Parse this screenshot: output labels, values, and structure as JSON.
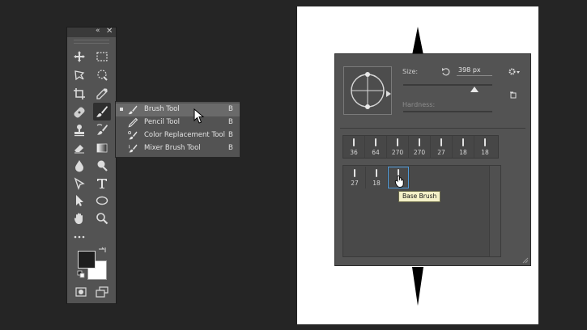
{
  "toolbar": {
    "collapse_glyph": "«",
    "close_glyph": "✕",
    "tools": [
      "move-icon",
      "marquee-icon",
      "lasso-icon",
      "quick-select-icon",
      "crop-icon",
      "eyedropper-icon",
      "healing-icon",
      "brush-icon",
      "stamp-icon",
      "history-brush-icon",
      "eraser-icon",
      "gradient-icon",
      "blur-icon",
      "dodge-icon",
      "pen-icon",
      "type-icon",
      "path-select-icon",
      "ellipse-icon",
      "hand-icon",
      "zoom-icon",
      "more-icon"
    ]
  },
  "flyout": {
    "items": [
      {
        "label": "Brush Tool",
        "key": "B",
        "selected": true,
        "icon": "brush-icon"
      },
      {
        "label": "Pencil Tool",
        "key": "B",
        "selected": false,
        "icon": "pencil-icon"
      },
      {
        "label": "Color Replacement Tool",
        "key": "B",
        "selected": false,
        "icon": "color-replacement-icon"
      },
      {
        "label": "Mixer Brush Tool",
        "key": "B",
        "selected": false,
        "icon": "mixer-brush-icon"
      }
    ]
  },
  "brush_panel": {
    "size_label": "Size:",
    "size_value": "398 px",
    "size_slider_fraction": 0.8,
    "hardness_label": "Hardness:",
    "hardness_slider_fraction": 0.0,
    "presets_row": [
      "36",
      "64",
      "270",
      "270",
      "27",
      "18",
      "18"
    ],
    "presets_list": [
      "27",
      "18",
      ""
    ],
    "tooltip": "Base Brush"
  },
  "colors": {
    "accent": "#4f9ad8",
    "panel": "#535353",
    "canvas": "#ffffff",
    "background": "#252525"
  }
}
